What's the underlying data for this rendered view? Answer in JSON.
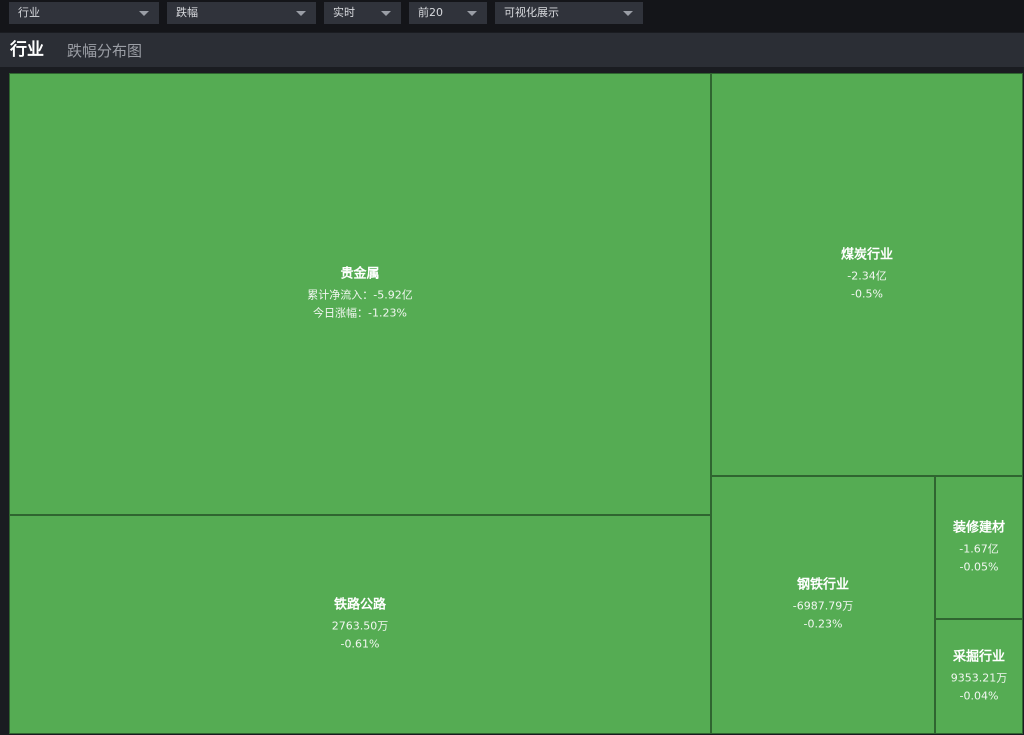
{
  "toolbar": {
    "category_select": "行业",
    "metric_select": "跌幅",
    "time_select": "实时",
    "top_select": "前20",
    "view_select": "可视化展示"
  },
  "header": {
    "title": "行业",
    "subtitle": "跌幅分布图"
  },
  "colors": {
    "page_background": "#1a1c21",
    "header_background": "#2b2e35",
    "tile_fill": "#55ac53",
    "tile_border": "#2f6530"
  },
  "treemap": {
    "tiles": [
      {
        "name": "贵金属",
        "line1": "累计净流入：-5.92亿",
        "line2": "今日涨幅：-1.23%"
      },
      {
        "name": "铁路公路",
        "line1": "2763.50万",
        "line2": "-0.61%"
      },
      {
        "name": "煤炭行业",
        "line1": "-2.34亿",
        "line2": "-0.5%"
      },
      {
        "name": "钢铁行业",
        "line1": "-6987.79万",
        "line2": "-0.23%"
      },
      {
        "name": "装修建材",
        "line1": "-1.67亿",
        "line2": "-0.05%"
      },
      {
        "name": "采掘行业",
        "line1": "9353.21万",
        "line2": "-0.04%"
      }
    ]
  }
}
